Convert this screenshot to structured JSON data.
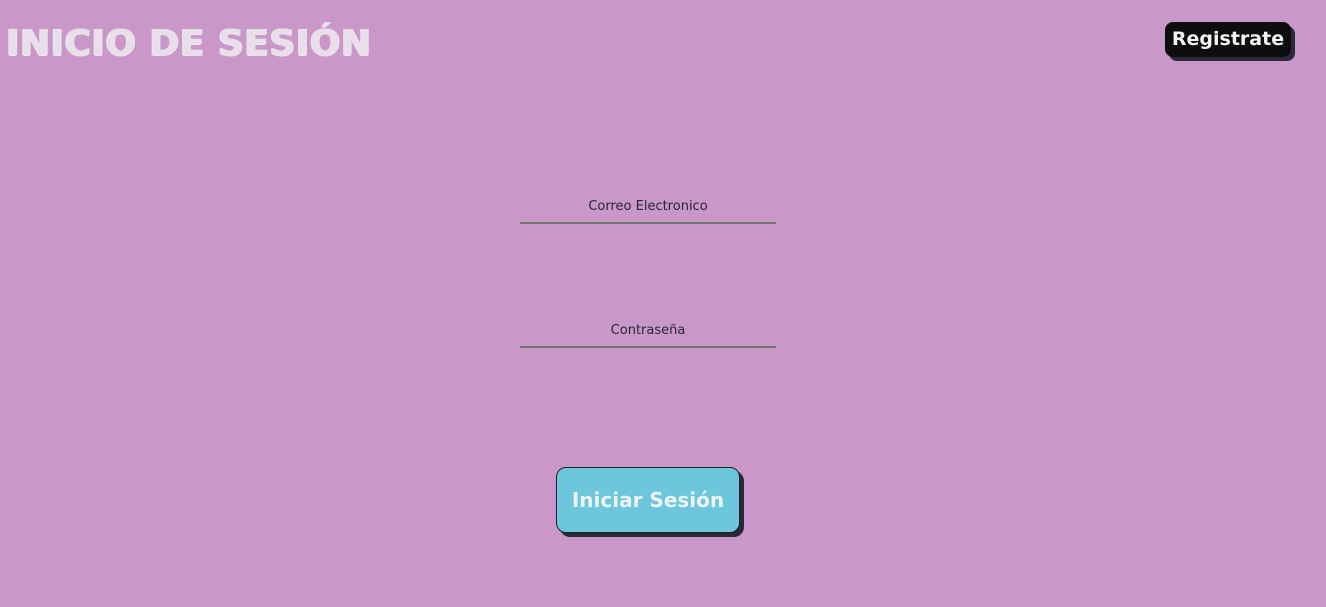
{
  "header": {
    "title": "INICIO DE SESIÓN",
    "register_label": "Registrate"
  },
  "form": {
    "email_placeholder": "Correo Electronico",
    "email_value": "",
    "password_placeholder": "Contraseña",
    "password_value": "",
    "submit_label": "Iniciar Sesión"
  },
  "colors": {
    "background": "#c998c9",
    "title": "#e9dfeb",
    "register_button": "#0e0e10",
    "submit_button": "#6cc6dc",
    "input_underline": "#6f7a6f"
  }
}
